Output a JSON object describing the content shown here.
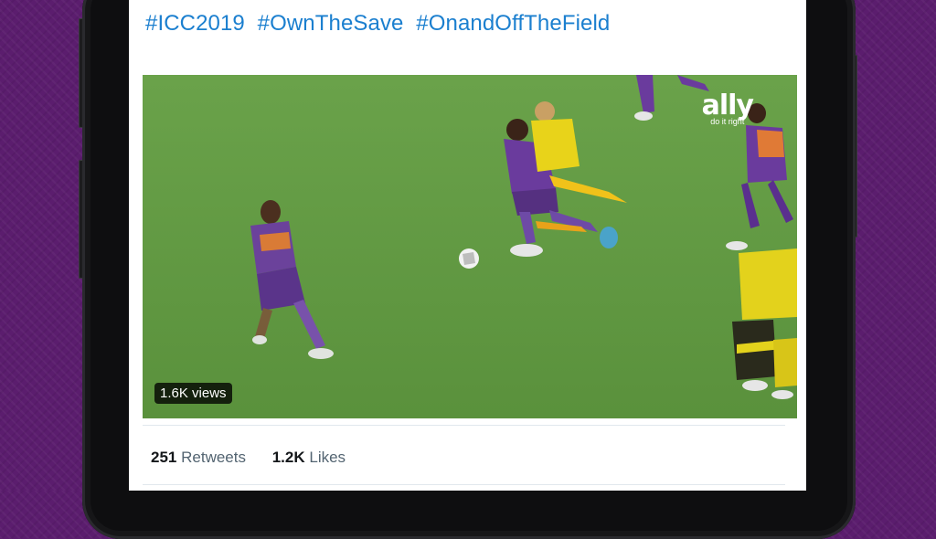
{
  "tweet": {
    "hashtags": [
      "#ICC2019",
      "#OwnTheSave",
      "#OnandOffTheField"
    ]
  },
  "video": {
    "views_label": "1.6K views",
    "sponsor_logo": "ally",
    "sponsor_tagline": "do it right"
  },
  "stats": {
    "retweets_count": "251",
    "retweets_label": "Retweets",
    "likes_count": "1.2K",
    "likes_label": "Likes"
  },
  "colors": {
    "background": "#5b1d6e",
    "hashtag": "#1b7fcf",
    "pitch": "#5d9740"
  }
}
